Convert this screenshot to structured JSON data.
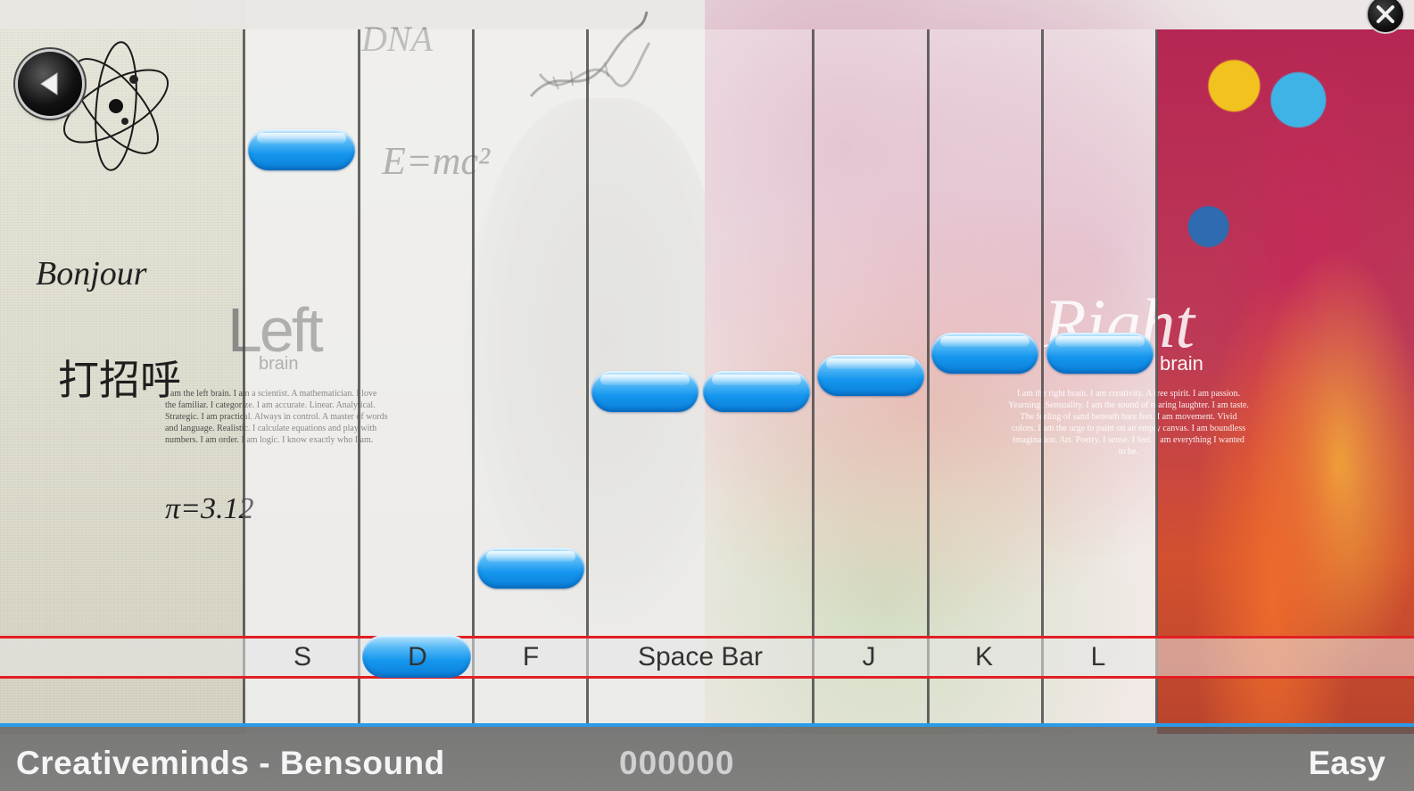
{
  "game": {
    "song_title": "Creativeminds - Bensound",
    "score": "000000",
    "difficulty": "Easy"
  },
  "lanes": {
    "keys": [
      "S",
      "D",
      "F",
      "Space Bar",
      "J",
      "K",
      "L"
    ],
    "active_key": "D"
  },
  "background_text": {
    "greeting_fr": "Bonjour",
    "greeting_cn": "打招呼",
    "pi": "π=3.12",
    "left_word": "Left",
    "left_sub": "brain",
    "right_word": "Right",
    "right_sub": "brain",
    "emc": "E=mc²",
    "dna": "DNA",
    "left_paragraph": "I am the left brain. I am a scientist. A mathematician. I love the familiar. I categorize. I am accurate. Linear. Analytical. Strategic. I am practical. Always in control. A master of words and language. Realistic. I calculate equations and play with numbers. I am order. I am logic. I know exactly who I am.",
    "right_paragraph": "I am the right brain. I am creativity. A free spirit. I am passion. Yearning. Sensuality. I am the sound of roaring laughter. I am taste. The feeling of sand beneath bare feet. I am movement. Vivid colors. I am the urge to paint on an empty canvas. I am boundless imagination. Art. Poetry. I sense. I feel. I am everything I wanted to be."
  },
  "icons": {
    "back": "back-arrow-icon",
    "close": "close-icon",
    "atom": "atom-icon"
  },
  "colors": {
    "note_blue": "#1596ee",
    "hit_line_red": "#e31e24",
    "bar_accent": "#2a9be8"
  }
}
